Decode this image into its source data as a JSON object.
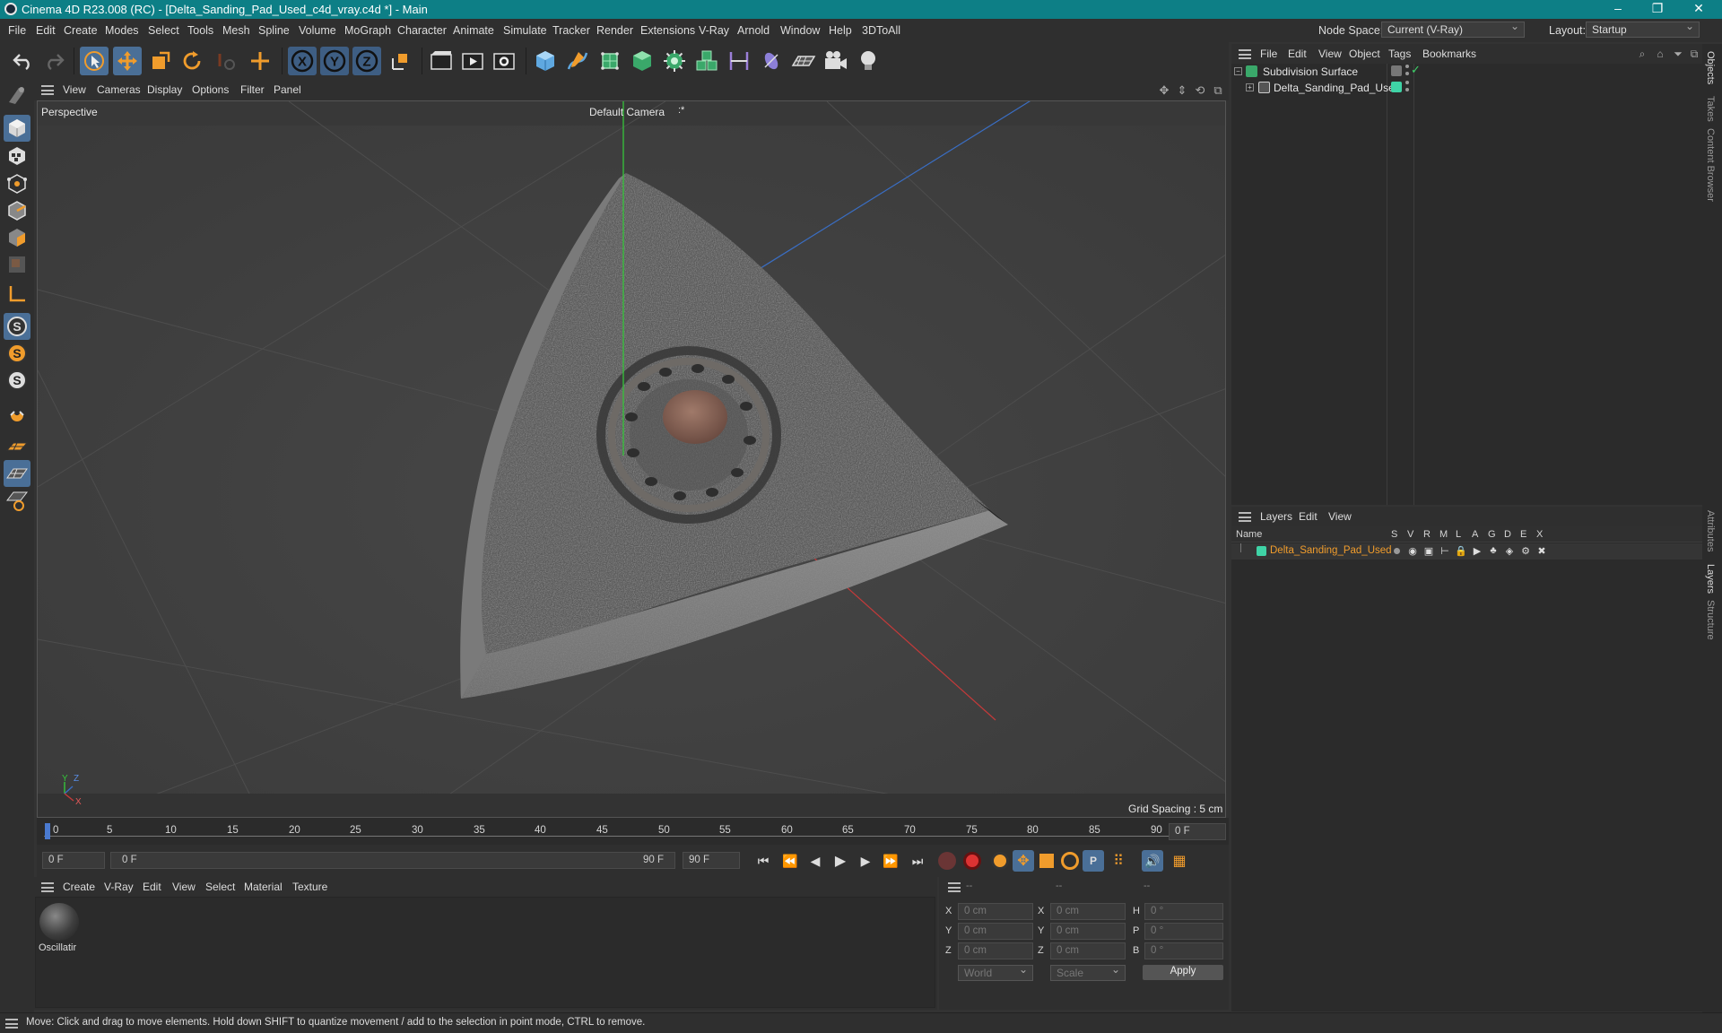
{
  "window": {
    "title": "Cinema 4D R23.008 (RC) - [Delta_Sanding_Pad_Used_c4d_vray.c4d *] - Main",
    "minimize": "–",
    "restore": "❐",
    "close": "✕"
  },
  "menu": {
    "items": [
      "File",
      "Edit",
      "Create",
      "Modes",
      "Select",
      "Tools",
      "Mesh",
      "Spline",
      "Volume",
      "MoGraph",
      "Character",
      "Animate",
      "Simulate",
      "Tracker",
      "Render",
      "Extensions",
      "V-Ray",
      "Arnold",
      "Window",
      "Help",
      "3DToAll"
    ],
    "node_space_label": "Node Space:",
    "node_space_value": "Current (V-Ray)",
    "layout_label": "Layout:",
    "layout_value": "Startup"
  },
  "viewport": {
    "menu": [
      "View",
      "Cameras",
      "Display",
      "Options",
      "Filter",
      "Panel"
    ],
    "name": "Perspective",
    "camera": "Default Camera",
    "camera_suffix": ":*",
    "grid_spacing": "Grid Spacing : 5 cm",
    "axis_y": "Y",
    "axis_z": "Z",
    "axis_x": "X"
  },
  "timeline": {
    "ticks": [
      "0",
      "5",
      "10",
      "15",
      "20",
      "25",
      "30",
      "35",
      "40",
      "45",
      "50",
      "55",
      "60",
      "65",
      "70",
      "75",
      "80",
      "85",
      "90"
    ],
    "current_frame": "0 F"
  },
  "transport": {
    "start_field": "0 F",
    "range_start": "0 F",
    "range_end": "90 F",
    "end_field": "90 F"
  },
  "materials": {
    "menu": [
      "Create",
      "V-Ray",
      "Edit",
      "View",
      "Select",
      "Material",
      "Texture"
    ],
    "items": [
      {
        "name": "Oscillatir"
      }
    ]
  },
  "coordinates": {
    "headers": [
      "--",
      "--",
      "--"
    ],
    "rows": [
      {
        "a_label": "X",
        "a_value": "0 cm",
        "b_label": "X",
        "b_value": "0 cm",
        "c_label": "H",
        "c_value": "0 °"
      },
      {
        "a_label": "Y",
        "a_value": "0 cm",
        "b_label": "Y",
        "b_value": "0 cm",
        "c_label": "P",
        "c_value": "0 °"
      },
      {
        "a_label": "Z",
        "a_value": "0 cm",
        "b_label": "Z",
        "b_value": "0 cm",
        "c_label": "B",
        "c_value": "0 °"
      }
    ],
    "mode_world": "World",
    "mode_scale": "Scale",
    "apply": "Apply"
  },
  "objects": {
    "menu": [
      "File",
      "Edit",
      "View",
      "Object",
      "Tags",
      "Bookmarks"
    ],
    "tree": [
      {
        "name": "Subdivision Surface"
      },
      {
        "name": "Delta_Sanding_Pad_Used"
      }
    ]
  },
  "layers": {
    "menu": [
      "Layers",
      "Edit",
      "View"
    ],
    "columns": [
      "Name",
      "S",
      "V",
      "R",
      "M",
      "L",
      "A",
      "G",
      "D",
      "E",
      "X"
    ],
    "rows": [
      {
        "name": "Delta_Sanding_Pad_Used",
        "color": "#3fd3a6"
      }
    ]
  },
  "side_tabs": [
    "Objects",
    "Takes",
    "Content Browser",
    "Attributes",
    "Layers",
    "Structure"
  ],
  "status": "Move: Click and drag to move elements. Hold down SHIFT to quantize movement / add to the selection in point mode, CTRL to remove.",
  "colors": {
    "titlebar": "#0d7f86",
    "selected": "#4a6f97",
    "accent_orange": "#f09c2c",
    "layer_green": "#3fd3a6"
  }
}
